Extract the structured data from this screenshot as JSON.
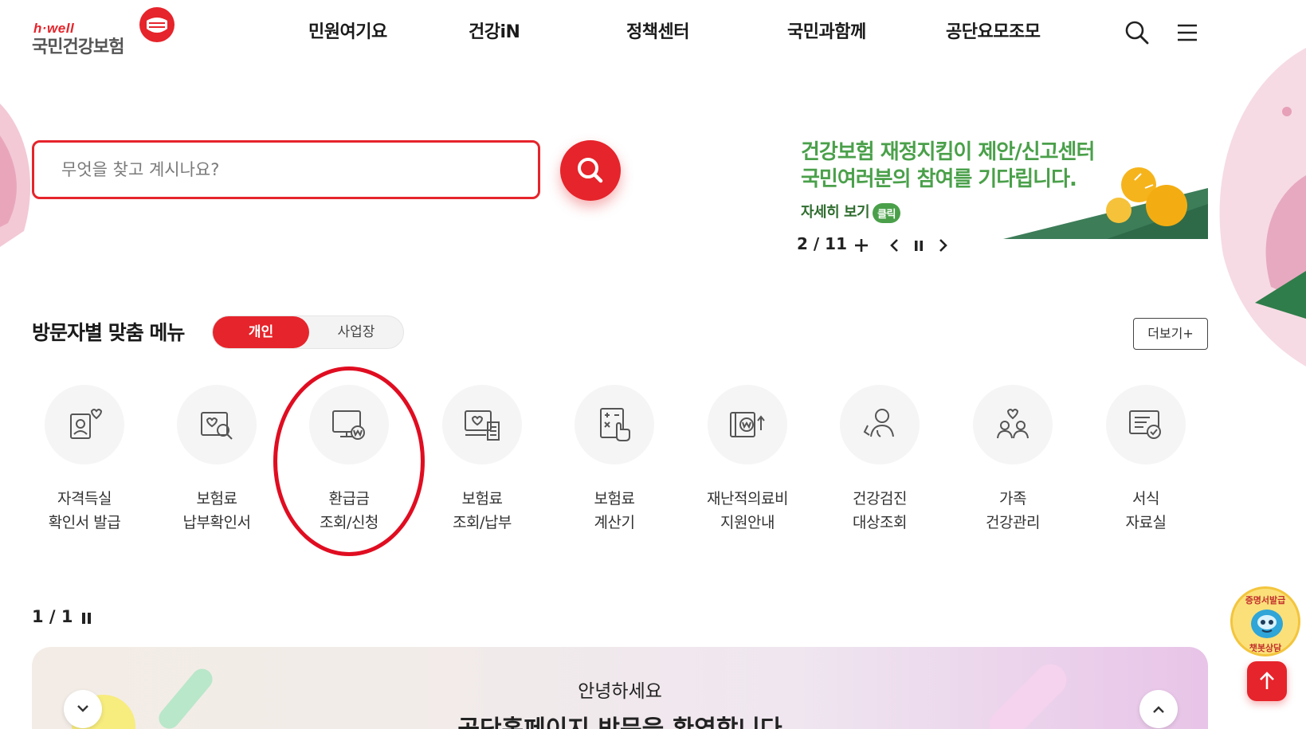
{
  "header": {
    "logo": {
      "tagline": "h·well",
      "name": "국민건강보험"
    },
    "nav": [
      {
        "label": "민원여기요"
      },
      {
        "label": "건강iN"
      },
      {
        "label": "정책센터"
      },
      {
        "label": "국민과함께"
      },
      {
        "label": "공단요모조모"
      }
    ],
    "icons": {
      "search": "search-icon",
      "menu": "hamburger-menu-icon"
    }
  },
  "search": {
    "placeholder": "무엇을 찾고 계시나요?",
    "value": ""
  },
  "banner": {
    "line1": "건강보험 재정지킴이 제안/신고센터",
    "line2": "국민여러분의 참여를 기다립니다.",
    "more": "자세히 보기",
    "click": "클릭",
    "counter": "2 / 11"
  },
  "custom_menu": {
    "title": "방문자별 맞춤 메뉴",
    "tabs": [
      {
        "label": "개인",
        "active": true
      },
      {
        "label": "사업장",
        "active": false
      }
    ],
    "more_label": "더보기+",
    "items": [
      {
        "line1": "자격득실",
        "line2": "확인서 발급",
        "icon": "certificate-person-icon"
      },
      {
        "line1": "보험료",
        "line2": "납부확인서",
        "icon": "document-search-icon"
      },
      {
        "line1": "환급금",
        "line2": "조회/신청",
        "icon": "monitor-won-icon"
      },
      {
        "line1": "보험료",
        "line2": "조회/납부",
        "icon": "monitor-receipt-icon"
      },
      {
        "line1": "보험료",
        "line2": "계산기",
        "icon": "calculator-icon"
      },
      {
        "line1": "재난적의료비",
        "line2": "지원안내",
        "icon": "money-support-icon"
      },
      {
        "line1": "건강검진",
        "line2": "대상조회",
        "icon": "health-checkup-icon"
      },
      {
        "line1": "가족",
        "line2": "건강관리",
        "icon": "family-heart-icon"
      },
      {
        "line1": "서식",
        "line2": "자료실",
        "icon": "form-document-icon"
      }
    ],
    "pager": "1 / 1"
  },
  "greeting": {
    "hello": "안녕하세요",
    "welcome": "공단홈페이지 방문을 환영합니다"
  },
  "chatbot": {
    "top": "증명서발급",
    "bottom": "챗봇상담"
  },
  "colors": {
    "brand": "#e6242b",
    "banner_green": "#4aa04a",
    "highlight": "#e00d21"
  }
}
